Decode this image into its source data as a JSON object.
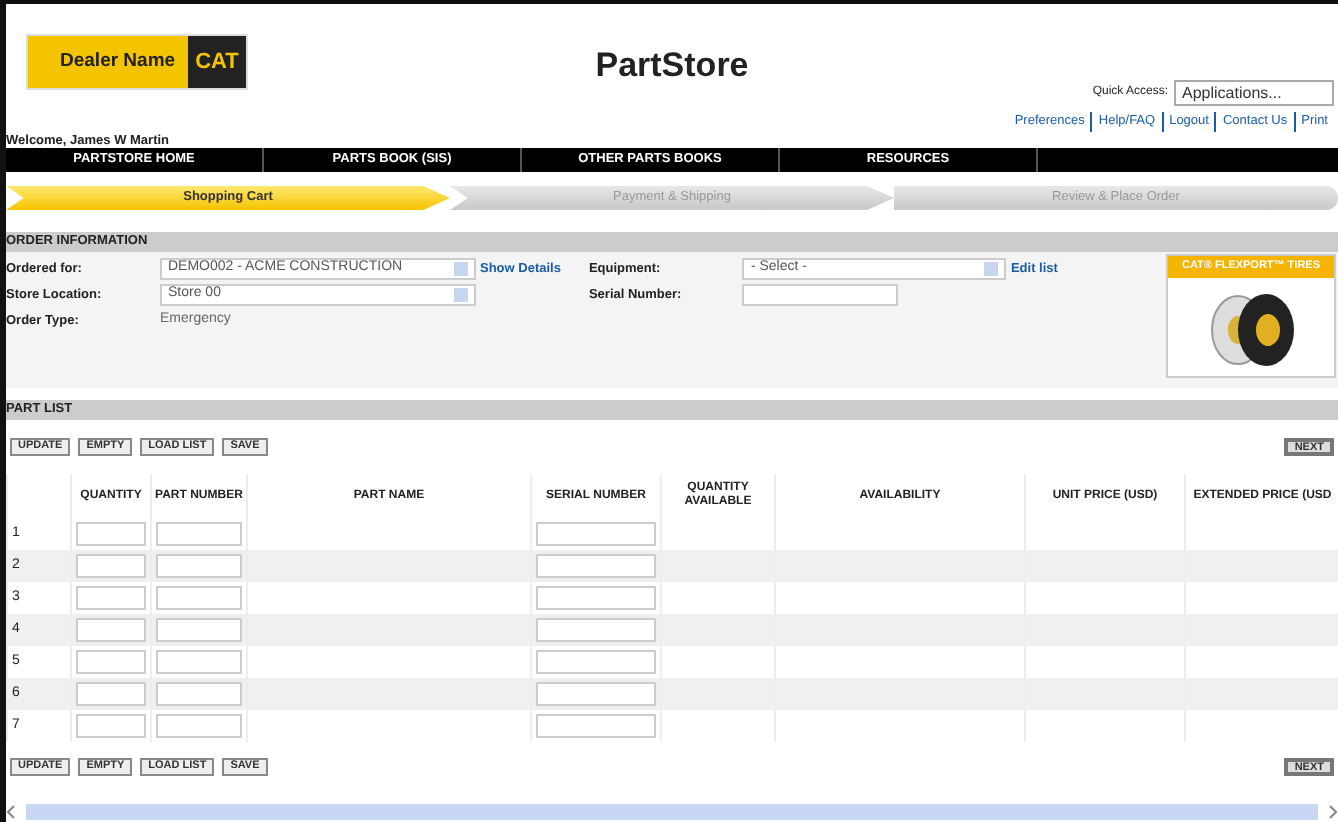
{
  "header": {
    "dealer_name": "Dealer Name",
    "brand": "CAT",
    "title": "PartStore",
    "welcome": "Welcome, James W Martin",
    "quick_access": {
      "label": "Quick Access:",
      "value": "Applications..."
    },
    "links": [
      "Preferences",
      "Help/FAQ",
      "Logout",
      "Contact Us",
      "Print"
    ]
  },
  "nav": [
    "PARTSTORE HOME",
    "PARTS BOOK (SIS)",
    "OTHER PARTS BOOKS",
    "RESOURCES"
  ],
  "steps": [
    {
      "label": "Shopping Cart",
      "selected": true
    },
    {
      "label": "Payment & Shipping",
      "selected": false
    },
    {
      "label": "Review & Place Order",
      "selected": false
    }
  ],
  "order_information": {
    "title": "ORDER INFORMATION",
    "left_fields": [
      {
        "label": "Ordered for:",
        "kind": "select",
        "value": "DEMO002 - ACME CONSTRUCTION",
        "link": "Show Details"
      },
      {
        "label": "Store Location:",
        "kind": "select",
        "value": "Store 00"
      },
      {
        "label": "Order Type:",
        "kind": "text",
        "value": "Emergency"
      }
    ],
    "right_fields": [
      {
        "label": "Equipment:",
        "kind": "select",
        "value": "- Select -",
        "link": "Edit list"
      },
      {
        "label": "Serial Number:",
        "kind": "input"
      }
    ]
  },
  "promo": {
    "title": "CAT® FLEXPORT™ TIRES"
  },
  "part_list": {
    "title": "PART LIST",
    "buttons": [
      "UPDATE",
      "EMPTY",
      "LOAD LIST",
      "SAVE"
    ],
    "next": "NEXT",
    "columns": [
      {
        "label": "QUANTITY",
        "kind": "input"
      },
      {
        "label": "PART NUMBER",
        "kind": "input"
      },
      {
        "label": "PART NAME",
        "kind": "text"
      },
      {
        "label": "SERIAL NUMBER",
        "kind": "input"
      },
      {
        "label": "QUANTITY AVAILABLE",
        "kind": "text"
      },
      {
        "label": "AVAILABILITY",
        "kind": "text"
      },
      {
        "label": "UNIT PRICE (USD)",
        "kind": "text"
      },
      {
        "label": "EXTENDED PRICE (USD",
        "kind": "text"
      }
    ],
    "rows": [
      "1",
      "2",
      "3",
      "4",
      "5",
      "6",
      "7"
    ],
    "bottom_buttons": [
      "UPDATE",
      "EMPTY",
      "LOAD LIST",
      "SAVE"
    ],
    "bottom_next": "NEXT"
  }
}
